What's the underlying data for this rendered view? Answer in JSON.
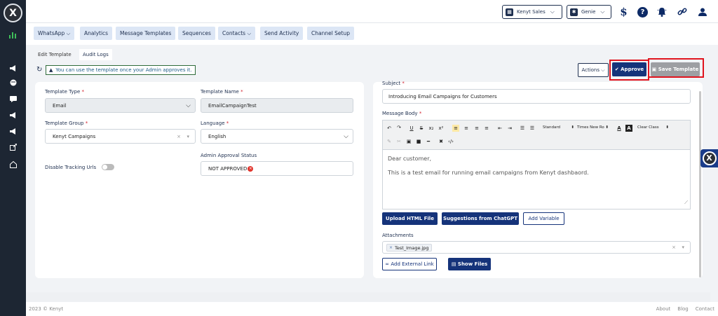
{
  "app": {
    "logo_letter": "X"
  },
  "topbar": {
    "account": "Kenyt Sales",
    "bot": "Genie",
    "icons": [
      "dollar-icon",
      "help-icon",
      "bell-icon",
      "link-icon",
      "user-icon"
    ],
    "help_glyph": "?",
    "dollar_glyph": "$"
  },
  "nav": {
    "items": [
      "WhatsApp",
      "Analytics",
      "Message Templates",
      "Sequences",
      "Contacts",
      "Send Activity",
      "Channel Setup"
    ],
    "chevron": "⌵"
  },
  "subtabs": {
    "edit": "Edit Template",
    "audit": "Audit Logs"
  },
  "notice": "You can use the template once your Admin approves it.",
  "actions": {
    "actions_label": "Actions",
    "approve_label": "Approve",
    "save_label": "Save Template"
  },
  "form": {
    "template_type_label": "Template Type",
    "template_type_value": "Email",
    "template_name_label": "Template Name",
    "template_name_value": "EmailCampaignTest",
    "template_group_label": "Template Group",
    "template_group_value": "Kenyt Campaigns",
    "language_label": "Language",
    "language_value": "English",
    "approval_status_label": "Admin Approval Status",
    "approval_status_value": "NOT APPROVED",
    "disable_tracking_label": "Disable Tracking Urls",
    "required_mark": "*",
    "disable_tracking_on": false
  },
  "email": {
    "subject_label": "Subject",
    "subject_value": "Introducing Email Campaigns for Customers",
    "body_label": "Message Body",
    "body_line1": "Dear customer,",
    "body_line2": "This is a test email for running email campaigns from Kenyt dashbaord.",
    "toolbar": {
      "format": "Standard",
      "font": "Times New Ro",
      "clear": "Clear Class",
      "buttons": [
        "↶",
        "↷",
        "U",
        "S",
        "x₂",
        "x²",
        "≡",
        "≡",
        "≡",
        "≡",
        "⇤",
        "⇥",
        "☰",
        "☰"
      ]
    },
    "upload_label": "Upload HTML File",
    "chatgpt_label": "Suggestions from ChatGPT",
    "variable_label": "Add Variable",
    "attachments_label": "Attachments",
    "attachment_file": "Test_Image.jpg",
    "external_link_label": "Add External Link",
    "show_files_label": "Show Files"
  },
  "footer": {
    "copyright": "2023 © Kenyt",
    "links": [
      "About",
      "Blog",
      "Contact"
    ]
  },
  "colors": {
    "navy": "#15337a",
    "sidebar": "#1d2633",
    "highlight_border": "#e0141e",
    "nav_bg": "#dce6f5"
  }
}
